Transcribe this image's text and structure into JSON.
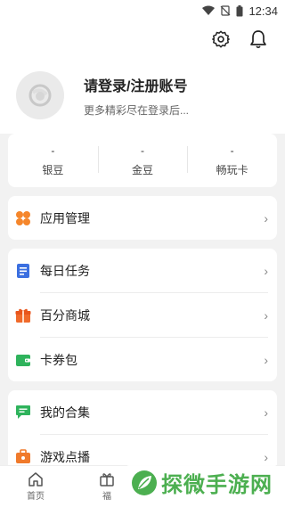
{
  "status_bar": {
    "time": "12:34"
  },
  "topbar": {
    "icons": [
      "gear-icon",
      "bell-icon"
    ]
  },
  "profile": {
    "title": "请登录/注册账号",
    "subtitle": "更多精彩尽在登录后..."
  },
  "stats": [
    {
      "value": "-",
      "label": "银豆"
    },
    {
      "value": "-",
      "label": "金豆"
    },
    {
      "value": "-",
      "label": "畅玩卡"
    }
  ],
  "menu_app": {
    "label": "应用管理"
  },
  "menu_group_1": [
    {
      "label": "每日任务",
      "icon": "clipboard-icon",
      "color": "#3b6fe0"
    },
    {
      "label": "百分商城",
      "icon": "gift-icon",
      "color": "#f06a2b"
    },
    {
      "label": "卡券包",
      "icon": "wallet-icon",
      "color": "#2fb35c"
    }
  ],
  "menu_group_2": [
    {
      "label": "我的合集",
      "icon": "chat-icon",
      "color": "#2fb35c"
    },
    {
      "label": "游戏点播",
      "icon": "briefcase-icon",
      "color": "#f07a2b"
    }
  ],
  "bottom_nav": [
    {
      "label": "首页",
      "icon": "home-icon"
    },
    {
      "label": "福",
      "icon": "gift-icon"
    }
  ],
  "watermark": {
    "text": "探微手游网"
  },
  "colors": {
    "accent_orange": "#f5862b",
    "accent_green": "#2fb35c",
    "accent_blue": "#3b6fe0"
  }
}
